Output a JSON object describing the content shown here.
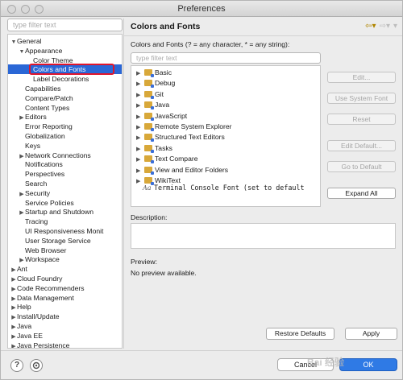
{
  "window": {
    "title": "Preferences"
  },
  "left": {
    "filter_placeholder": "type filter text",
    "tree": [
      {
        "label": "General",
        "arrow": "▼",
        "indent": 0
      },
      {
        "label": "Appearance",
        "arrow": "▼",
        "indent": 1
      },
      {
        "label": "Color Theme",
        "arrow": "",
        "indent": 2
      },
      {
        "label": "Colors and Fonts",
        "arrow": "",
        "indent": 2,
        "selected": true
      },
      {
        "label": "Label Decorations",
        "arrow": "",
        "indent": 2
      },
      {
        "label": "Capabilities",
        "arrow": "",
        "indent": 1
      },
      {
        "label": "Compare/Patch",
        "arrow": "",
        "indent": 1
      },
      {
        "label": "Content Types",
        "arrow": "",
        "indent": 1
      },
      {
        "label": "Editors",
        "arrow": "▶",
        "indent": 1
      },
      {
        "label": "Error Reporting",
        "arrow": "",
        "indent": 1
      },
      {
        "label": "Globalization",
        "arrow": "",
        "indent": 1
      },
      {
        "label": "Keys",
        "arrow": "",
        "indent": 1
      },
      {
        "label": "Network Connections",
        "arrow": "▶",
        "indent": 1
      },
      {
        "label": "Notifications",
        "arrow": "",
        "indent": 1
      },
      {
        "label": "Perspectives",
        "arrow": "",
        "indent": 1
      },
      {
        "label": "Search",
        "arrow": "",
        "indent": 1
      },
      {
        "label": "Security",
        "arrow": "▶",
        "indent": 1
      },
      {
        "label": "Service Policies",
        "arrow": "",
        "indent": 1
      },
      {
        "label": "Startup and Shutdown",
        "arrow": "▶",
        "indent": 1
      },
      {
        "label": "Tracing",
        "arrow": "",
        "indent": 1
      },
      {
        "label": "UI Responsiveness Monit",
        "arrow": "",
        "indent": 1
      },
      {
        "label": "User Storage Service",
        "arrow": "",
        "indent": 1
      },
      {
        "label": "Web Browser",
        "arrow": "",
        "indent": 1
      },
      {
        "label": "Workspace",
        "arrow": "▶",
        "indent": 1
      },
      {
        "label": "Ant",
        "arrow": "▶",
        "indent": 0
      },
      {
        "label": "Cloud Foundry",
        "arrow": "▶",
        "indent": 0
      },
      {
        "label": "Code Recommenders",
        "arrow": "▶",
        "indent": 0
      },
      {
        "label": "Data Management",
        "arrow": "▶",
        "indent": 0
      },
      {
        "label": "Help",
        "arrow": "▶",
        "indent": 0
      },
      {
        "label": "Install/Update",
        "arrow": "▶",
        "indent": 0
      },
      {
        "label": "Java",
        "arrow": "▶",
        "indent": 0
      },
      {
        "label": "Java EE",
        "arrow": "▶",
        "indent": 0
      },
      {
        "label": "Java Persistence",
        "arrow": "▶",
        "indent": 0
      }
    ]
  },
  "right": {
    "title": "Colors and Fonts",
    "subtitle": "Colors and Fonts (? = any character, * = any string):",
    "filter_placeholder": "type filter text",
    "categories": [
      {
        "label": "Basic"
      },
      {
        "label": "Debug"
      },
      {
        "label": "Git"
      },
      {
        "label": "Java"
      },
      {
        "label": "JavaScript"
      },
      {
        "label": "Remote System Explorer"
      },
      {
        "label": "Structured Text Editors"
      },
      {
        "label": "Tasks"
      },
      {
        "label": "Text Compare"
      },
      {
        "label": "View and Editor Folders"
      },
      {
        "label": "WikiText"
      }
    ],
    "font_item": {
      "icon": "Aa",
      "label": "Terminal Console Font (set to default"
    },
    "buttons": {
      "edit": "Edit...",
      "use_system_font": "Use System Font",
      "reset": "Reset",
      "edit_default": "Edit Default...",
      "go_to_default": "Go to Default",
      "expand_all": "Expand All"
    },
    "description_label": "Description:",
    "preview_label": "Preview:",
    "preview_text": "No preview available.",
    "restore_defaults": "Restore Defaults",
    "apply": "Apply"
  },
  "bottom": {
    "help_icon": "?",
    "cancel": "Cancel",
    "ok": "OK"
  },
  "watermark": "Bai 经验",
  "colors": {
    "selection": "#2a67d6",
    "highlight_box": "#e0152c",
    "primary_button": "#2f7ae5"
  }
}
